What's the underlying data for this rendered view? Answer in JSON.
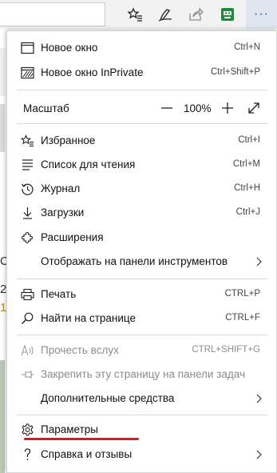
{
  "menu": {
    "items": [
      {
        "label": "Новое окно",
        "shortcut": "Ctrl+N",
        "icon": "window-icon"
      },
      {
        "label": "Новое окно InPrivate",
        "shortcut": "Ctrl+Shift+P",
        "icon": "inprivate-window-icon"
      },
      {
        "label": "Избранное",
        "shortcut": "Ctrl+I",
        "icon": "favorites-star-icon"
      },
      {
        "label": "Список для чтения",
        "shortcut": "Ctrl+M",
        "icon": "reading-list-icon"
      },
      {
        "label": "Журнал",
        "shortcut": "Ctrl+H",
        "icon": "history-icon"
      },
      {
        "label": "Загрузки",
        "shortcut": "Ctrl+J",
        "icon": "download-icon"
      },
      {
        "label": "Расширения",
        "shortcut": "",
        "icon": "extensions-puzzle-icon"
      },
      {
        "label": "Отображать на панели инструментов",
        "shortcut": "",
        "icon": ""
      },
      {
        "label": "Печать",
        "shortcut": "CTRL+P",
        "icon": "print-icon"
      },
      {
        "label": "Найти на странице",
        "shortcut": "CTRL+F",
        "icon": "search-icon"
      },
      {
        "label": "Прочесть вслух",
        "shortcut": "CTRL+SHIFT+G",
        "icon": "read-aloud-icon"
      },
      {
        "label": "Закрепить эту страницу на панели задач",
        "shortcut": "",
        "icon": "pin-icon"
      },
      {
        "label": "Дополнительные средства",
        "shortcut": "",
        "icon": ""
      },
      {
        "label": "Параметры",
        "shortcut": "",
        "icon": "settings-gear-icon"
      },
      {
        "label": "Справка и отзывы",
        "shortcut": "",
        "icon": "help-icon"
      }
    ],
    "zoom": {
      "label": "Масштаб",
      "value": "100%",
      "minus": "—",
      "plus": "+"
    }
  },
  "toolbar": {
    "more": "···"
  },
  "background": {
    "frag_a": "С",
    "frag_b": "2",
    "frag_c": "1"
  },
  "colors": {
    "accent": "#0a5fb8",
    "highlight_underline": "#e3161d",
    "extension_green": "#1e8a3c"
  }
}
